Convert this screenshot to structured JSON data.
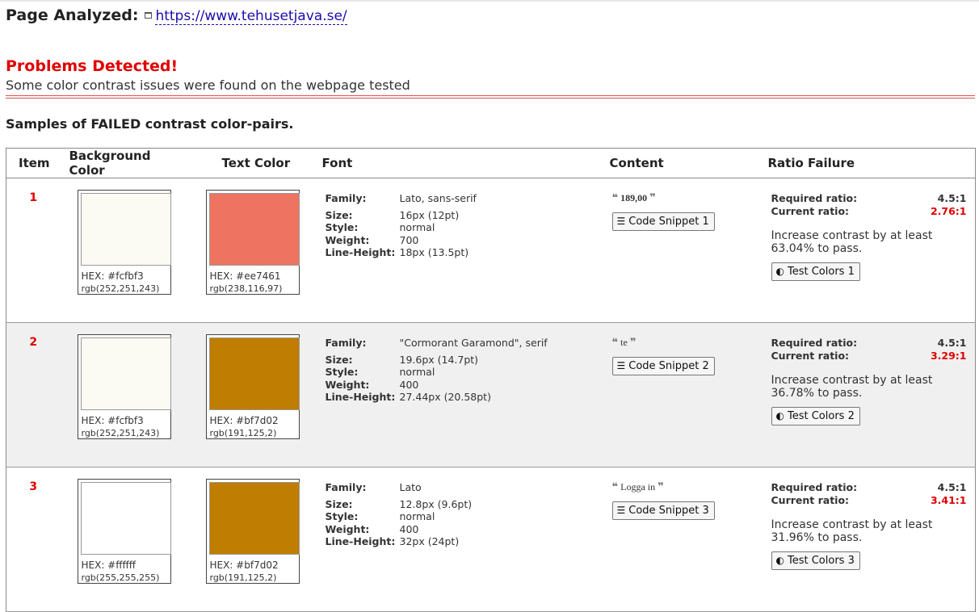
{
  "header": {
    "label": "Page Analyzed:",
    "url": "https://www.tehusetjava.se/"
  },
  "problems": {
    "title": "Problems Detected!",
    "subtitle": "Some color contrast issues were found on the webpage tested"
  },
  "samples_title": "Samples of FAILED contrast color-pairs.",
  "table": {
    "columns": [
      "Item",
      "Background Color",
      "Text Color",
      "Font",
      "Content",
      "Ratio Failure"
    ],
    "font_keys": {
      "family": "Family:",
      "size": "Size:",
      "style": "Style:",
      "weight": "Weight:",
      "line_height": "Line-Height:"
    },
    "ratio_keys": {
      "required": "Required ratio:",
      "current": "Current ratio:"
    },
    "rows": [
      {
        "item": "1",
        "bg": {
          "hex_label": "HEX: #fcfbf3",
          "rgb_label": "rgb(252,251,243)",
          "color": "#fcfbf3"
        },
        "text": {
          "hex_label": "HEX: #ee7461",
          "rgb_label": "rgb(238,116,97)",
          "color": "#ee7461"
        },
        "font": {
          "family": "Lato, sans-serif",
          "size": "16px (12pt)",
          "style": "normal",
          "weight": "700",
          "line_height": "18px (13.5pt)"
        },
        "content": "189,00",
        "snippet_label": "Code Snippet 1",
        "required": "4.5:1",
        "current": "2.76:1",
        "advice": "Increase contrast by at least 63.04% to pass.",
        "test_label": "Test Colors 1"
      },
      {
        "item": "2",
        "bg": {
          "hex_label": "HEX: #fcfbf3",
          "rgb_label": "rgb(252,251,243)",
          "color": "#fcfbf3"
        },
        "text": {
          "hex_label": "HEX: #bf7d02",
          "rgb_label": "rgb(191,125,2)",
          "color": "#bf7d02"
        },
        "font": {
          "family": "\"Cormorant Garamond\", serif",
          "size": "19.6px (14.7pt)",
          "style": "normal",
          "weight": "400",
          "line_height": "27.44px (20.58pt)"
        },
        "content": "te",
        "snippet_label": "Code Snippet 2",
        "required": "4.5:1",
        "current": "3.29:1",
        "advice": "Increase contrast by at least 36.78% to pass.",
        "test_label": "Test Colors 2"
      },
      {
        "item": "3",
        "bg": {
          "hex_label": "HEX: #ffffff",
          "rgb_label": "rgb(255,255,255)",
          "color": "#ffffff"
        },
        "text": {
          "hex_label": "HEX: #bf7d02",
          "rgb_label": "rgb(191,125,2)",
          "color": "#bf7d02"
        },
        "font": {
          "family": "Lato",
          "size": "12.8px (9.6pt)",
          "style": "normal",
          "weight": "400",
          "line_height": "32px (24pt)"
        },
        "content": "Logga in",
        "snippet_label": "Code Snippet 3",
        "required": "4.5:1",
        "current": "3.41:1",
        "advice": "Increase contrast by at least 31.96% to pass.",
        "test_label": "Test Colors 3"
      }
    ]
  },
  "icons": {
    "open_quote": "open-quote-icon",
    "close_quote": "close-quote-icon",
    "snippet": "list-icon",
    "test": "contrast-icon",
    "external": "new-window-icon"
  },
  "colors": {
    "alert_red": "#e00000",
    "link_blue": "#1a0dab",
    "alt_row": "#f0f0f0"
  }
}
